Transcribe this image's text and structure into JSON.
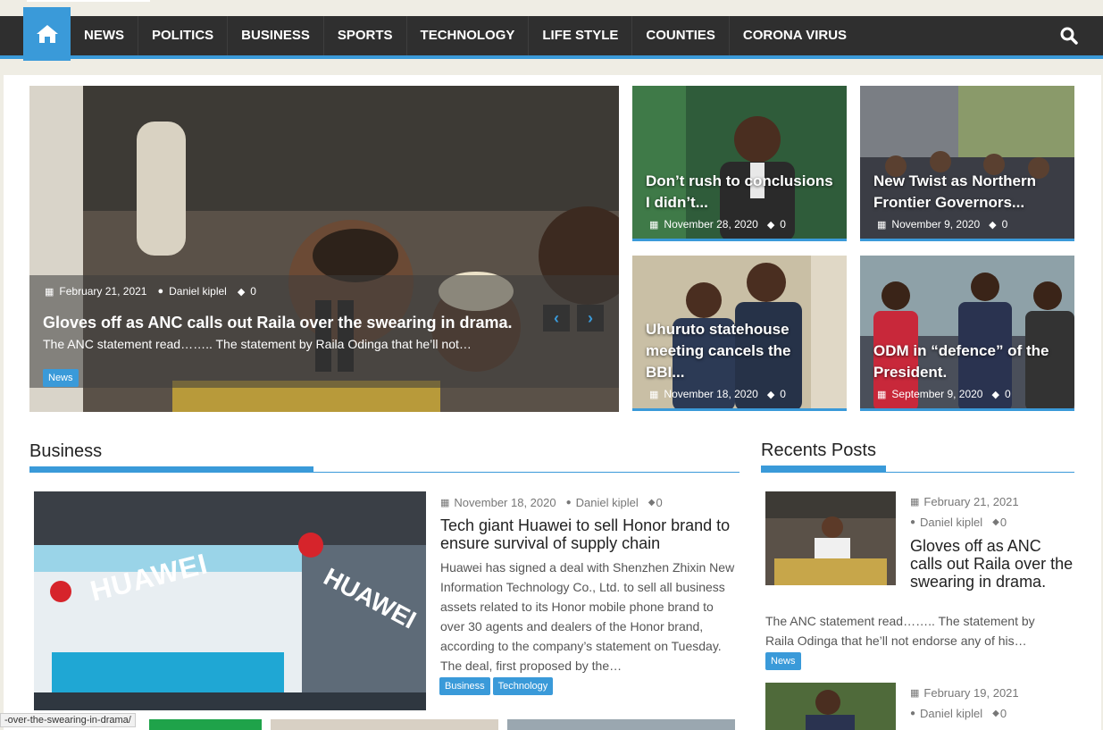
{
  "nav": {
    "items": [
      "NEWS",
      "POLITICS",
      "BUSINESS",
      "SPORTS",
      "TECHNOLOGY",
      "LIFE STYLE",
      "COUNTIES",
      "CORONA VIRUS"
    ]
  },
  "slider": {
    "date": "February 21, 2021",
    "author": "Daniel kiplel",
    "comments": "0",
    "title": "Gloves off as ANC calls out Raila over the swearing in drama.",
    "excerpt": "The ANC statement read…….. The statement by Raila Odinga that he’ll not…",
    "category": "News",
    "prev": "‹",
    "next": "›"
  },
  "tiles": [
    {
      "title": "Don’t rush to conclusions I didn’t...",
      "date": "November 28, 2020",
      "comments": "0"
    },
    {
      "title": "New Twist as Northern Frontier Governors...",
      "date": "November 9, 2020",
      "comments": "0"
    },
    {
      "title": "Uhuruto statehouse meeting cancels the BBI...",
      "date": "November 18, 2020",
      "comments": "0"
    },
    {
      "title": "ODM in “defence” of the President.",
      "date": "September 9, 2020",
      "comments": "0"
    }
  ],
  "business": {
    "heading": "Business",
    "date": "November 18, 2020",
    "author": "Daniel kiplel",
    "comments": "0",
    "title": "Tech giant Huawei to sell Honor brand to ensure survival of supply chain",
    "body": "Huawei has signed a deal with Shenzhen Zhixin New Information Technology Co., Ltd. to sell all business assets related to its Honor mobile phone brand to over 30 agents and dealers of the Honor brand, according to the company’s statement on Tuesday. The deal, first proposed by the…",
    "tags": [
      "Business",
      "Technology"
    ],
    "image_sign": "HUAWEI"
  },
  "recent": {
    "heading": "Recents Posts",
    "posts": [
      {
        "date": "February 21, 2021",
        "author": "Daniel kiplel",
        "comments": "0",
        "title": "Gloves off as ANC calls out Raila over the swearing in drama.",
        "excerpt": "The ANC statement read…….. The statement by Raila Odinga that he’ll not endorse any of his…",
        "category": "News"
      },
      {
        "date": "February 19, 2021",
        "author": "Daniel kiplel",
        "comments": "0"
      }
    ]
  },
  "status": {
    "url": "-over-the-swearing-in-drama/"
  },
  "colors": {
    "accent": "#3a9ad9",
    "nav_bg": "#2f2f2f",
    "page_bg": "#efede4"
  }
}
